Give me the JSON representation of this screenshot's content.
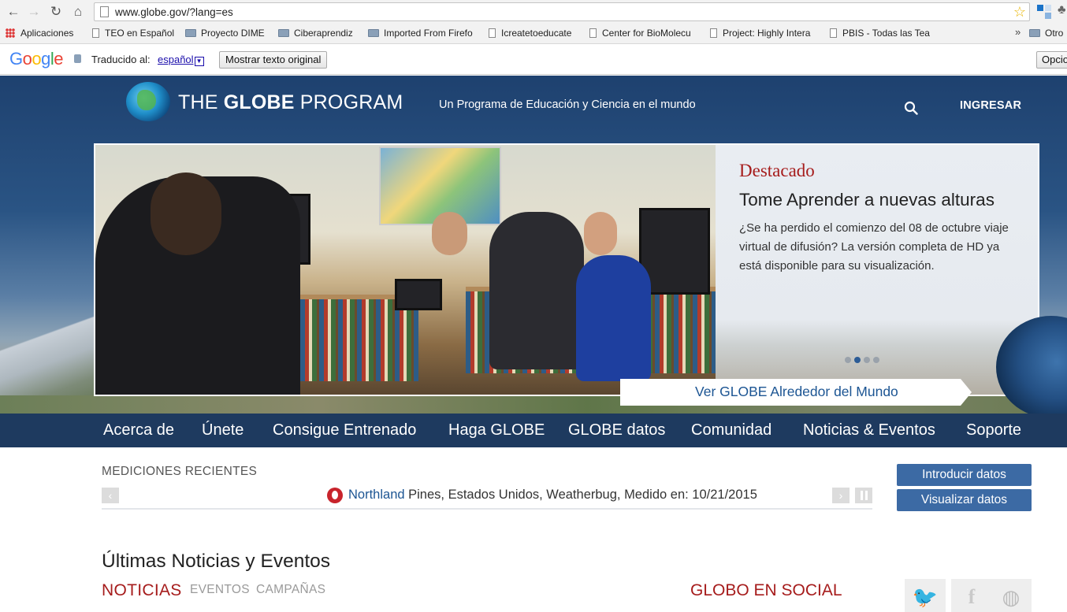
{
  "browser": {
    "url": "www.globe.gov/?lang=es",
    "bookmarks": [
      "Aplicaciones",
      "TEO en Español",
      "Proyecto DIME",
      "Ciberaprendiz",
      "Imported From Firefo",
      "Icreatetoeducate",
      "Center for BioMolecu",
      "Project: Highly Intera",
      "PBIS - Todas las Tea",
      "Otro"
    ],
    "bookmarks_more": "»"
  },
  "translate": {
    "google": "Google",
    "label": "Traducido al:",
    "language": "español",
    "show_original": "Mostrar texto original",
    "options": "Opcio"
  },
  "header": {
    "logo_pre": "THE ",
    "logo_bold": "GLOBE",
    "logo_post": " PROGRAM",
    "tagline": "Un Programa de Educación y Ciencia en el mundo",
    "login": "INGRESAR"
  },
  "feature": {
    "kicker": "Destacado",
    "title": "Tome Aprender a nuevas alturas",
    "body": "¿Se ha perdido el comienzo del 08 de octubre viaje virtual de difusión? La versión completa de HD ya está disponible para su visualización.",
    "slide_count": 4,
    "active_slide": 2,
    "world_link": "Ver GLOBE Alrededor del Mundo"
  },
  "nav": [
    "Acerca de",
    "Únete",
    "Consigue Entrenado",
    "Haga GLOBE",
    "GLOBE datos",
    "Comunidad",
    "Noticias & Eventos",
    "Soporte"
  ],
  "measurements": {
    "title": "MEDICIONES RECIENTES",
    "location_link": "Northland",
    "text": " Pines, Estados Unidos, Weatherbug, Medido en: 10/21/2015"
  },
  "data_buttons": {
    "enter": "Introducir datos",
    "view": "Visualizar datos"
  },
  "news": {
    "heading": "Últimas Noticias y Eventos",
    "tabs": [
      "NOTICIAS",
      "EVENTOS",
      "CAMPAÑAS"
    ],
    "social_title": "GLOBO EN SOCIAL"
  },
  "colors": {
    "brand_blue": "#1e3a5f",
    "accent_red": "#a61c1c",
    "button_blue": "#3c6aa4",
    "link_blue": "#1c5593"
  }
}
